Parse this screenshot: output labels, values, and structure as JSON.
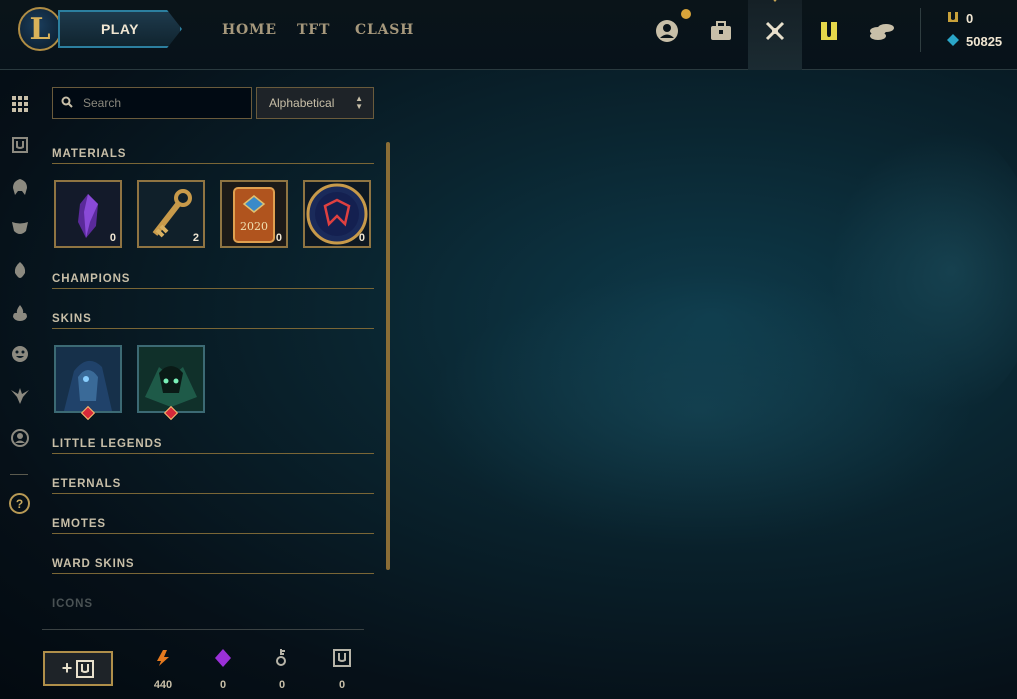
{
  "topbar": {
    "logo_letter": "L",
    "play_label": "PLAY",
    "nav": [
      "HOME",
      "TFT",
      "CLASH"
    ],
    "icons": [
      "profile-icon",
      "collection-icon",
      "loot-icon",
      "store-icon",
      "currency-icon"
    ],
    "currencies": [
      {
        "icon": "orange-essence-icon",
        "value": "0"
      },
      {
        "icon": "blue-essence-icon",
        "value": "50825"
      }
    ]
  },
  "rail": {
    "icons": [
      "all-items-icon",
      "chests-icon",
      "champions-icon",
      "skins-icon",
      "little-legends-icon",
      "eternals-icon",
      "emotes-icon",
      "ward-skins-icon",
      "icons-icon"
    ],
    "help_label": "?"
  },
  "search": {
    "placeholder": "Search"
  },
  "sort": {
    "selected": "Alphabetical"
  },
  "sections": {
    "materials": "MATERIALS",
    "champions": "CHAMPIONS",
    "skins": "SKINS",
    "little_legends": "LITTLE LEGENDS",
    "eternals": "ETERNALS",
    "emotes": "EMOTES",
    "ward_skins": "WARD SKINS",
    "icons": "ICONS"
  },
  "materials": [
    {
      "name": "mythic-essence",
      "count": "0"
    },
    {
      "name": "hextech-key",
      "count": "2"
    },
    {
      "name": "2020 capsule",
      "count": "0"
    },
    {
      "name": "worlds-orb",
      "count": "0"
    }
  ],
  "material_capsule_year": "2020",
  "skins": [
    {
      "name": "skin-shard-1"
    },
    {
      "name": "skin-shard-2"
    }
  ],
  "bottom": {
    "craft_label": "+",
    "resources": [
      {
        "icon": "orange-essence-icon",
        "value": "440",
        "color": "#e67a1f"
      },
      {
        "icon": "mythic-essence-icon",
        "value": "0",
        "color": "#9b30d8"
      },
      {
        "icon": "key-fragment-icon",
        "value": "0",
        "color": "#b7b4a8"
      },
      {
        "icon": "chest-icon",
        "value": "0",
        "color": "#b7b4a8"
      }
    ]
  },
  "colors": {
    "gold": "#c8aa6e",
    "accent_blue": "#2c7f9f"
  }
}
